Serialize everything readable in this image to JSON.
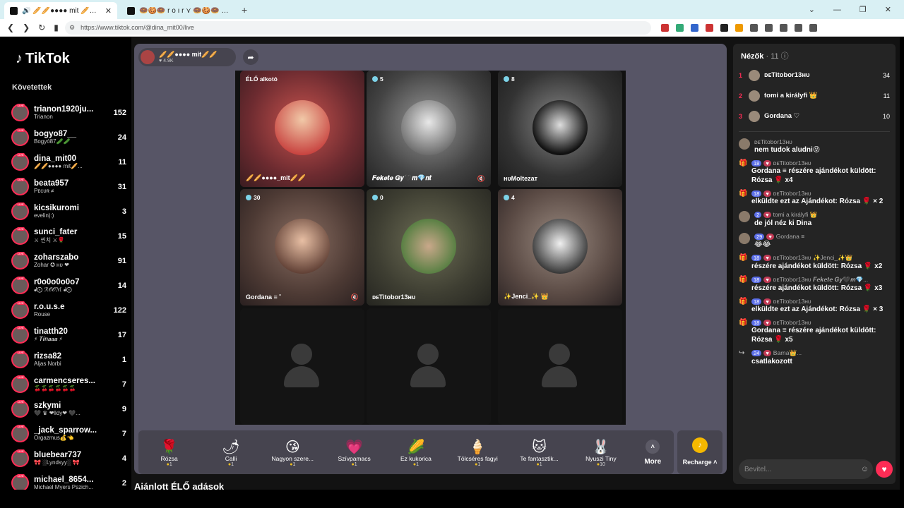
{
  "browser": {
    "tabs": [
      {
        "title": "🔊 🥖🥖●●●● mit 🥖🥖 (@…",
        "close": "✕"
      },
      {
        "title": "🍩🍪🍩 r o ı r ⋎ 🍩🍪🍩 (@tiktok.ro…"
      }
    ],
    "new_tab": "+",
    "url": "https://www.tiktok.com/@dina_mit00/live"
  },
  "sidebar": {
    "logo": "TikTok",
    "following_title": "Követettek",
    "items": [
      {
        "name": "trianon1920ju...",
        "sub": "Trianon",
        "count": "152"
      },
      {
        "name": "bogyo87__",
        "sub": "Bogyó87🥒🥒",
        "count": "24"
      },
      {
        "name": "dina_mit00",
        "sub": "🥖🥖●●●● mit🥖...",
        "count": "11"
      },
      {
        "name": "beata957",
        "sub": "Pᴇᴄᴜʀ ≠",
        "count": "31"
      },
      {
        "name": "kicsikuromi",
        "sub": "evelin):)",
        "count": "3"
      },
      {
        "name": "sunci_fater",
        "sub": "⚔ 씬치 ⚔🌹",
        "count": "15"
      },
      {
        "name": "zoharszabo",
        "sub": "Zohar ✪ ʜᴜ ❤",
        "count": "91"
      },
      {
        "name": "r0o0o0o0o7",
        "sub": "ᖱ⨀ ℛ𝒪𝒪ℳ ᖱ⨀",
        "count": "14"
      },
      {
        "name": "r.o.u.s.e",
        "sub": "Rouse",
        "count": "122"
      },
      {
        "name": "tinatth20",
        "sub": "⚡ 𝑻𝒊𝒏𝒂𝒂𝒂 ⚡",
        "count": "17"
      },
      {
        "name": "rizsa82",
        "sub": "Aljas Norbi",
        "count": "1"
      },
      {
        "name": "carmencseres...",
        "sub": "🍒🍒🍒🍒🍒🍒",
        "count": "7"
      },
      {
        "name": "szkymi",
        "sub": "🖤 ♛ ❤lldy❤ 🖤...",
        "count": "9"
      },
      {
        "name": "_jack_sparrow...",
        "sub": "Orgazmus💰👈",
        "count": "7"
      },
      {
        "name": "bluebear737",
        "sub": "🎀 ░Lyndsyy░ 🎀",
        "count": "4"
      },
      {
        "name": "michael_8654...",
        "sub": "Michael Myers Pszich...",
        "count": "2"
      }
    ]
  },
  "host": {
    "name": "🥖🥖●●●● mit🥖🥖",
    "likes": "♥ 4.9K"
  },
  "grid": {
    "cells": [
      {
        "badge": "ÉLŐ alkotó",
        "name": "🥖🥖●●●●_mit🥖🥖",
        "viewers": ""
      },
      {
        "badge": "5",
        "name": "𝑭𝒆𝒌𝒆𝒕𝒆 𝑮𝒚🖤𝒎💎𝒏𝒕",
        "viewers": "5"
      },
      {
        "badge": "8",
        "name": "ʜᴜMoltezaт",
        "viewers": "8"
      },
      {
        "badge": "30",
        "name": "Gordana ≡ ˚",
        "viewers": "30"
      },
      {
        "badge": "0",
        "name": "ᴅᴇTitobor13ʜᴜ",
        "viewers": "0"
      },
      {
        "badge": "4",
        "name": "✨Jenci_✨ 👑",
        "viewers": "4"
      }
    ]
  },
  "gifts": [
    {
      "icon": "🌹",
      "name": "Rózsa",
      "price": "1"
    },
    {
      "icon": "🌶",
      "name": "Calli",
      "price": "1"
    },
    {
      "icon": "😘",
      "name": "Nagyon szere...",
      "price": "1"
    },
    {
      "icon": "💗",
      "name": "Szívpamacs",
      "price": "1"
    },
    {
      "icon": "🌽",
      "name": "Ez kukorica",
      "price": "1"
    },
    {
      "icon": "🍦",
      "name": "Tölcséres fagyi",
      "price": "1"
    },
    {
      "icon": "🐱",
      "name": "Te fantasztik...",
      "price": "1"
    },
    {
      "icon": "🐰",
      "name": "Nyuszi Tiny",
      "price": "10"
    }
  ],
  "more_label": "More",
  "recharge_label": "Recharge ˄",
  "recommended_title": "Ajánlott ÉLŐ adások",
  "viewers_panel": {
    "title": "Nézők",
    "count": "· 11",
    "top": [
      {
        "rank": "1",
        "name": "ᴅᴇTitobor13ʜᴜ",
        "score": "34"
      },
      {
        "rank": "2",
        "name": "tomi a királyfi 👑",
        "score": "11"
      },
      {
        "rank": "3",
        "name": "Gordana ♡",
        "score": "10"
      }
    ]
  },
  "chat": [
    {
      "icon": "",
      "meta": "ᴅᴇTitobor13ʜᴜ",
      "text": "nem tudok aludni😜"
    },
    {
      "icon": "🎁",
      "meta": "ᴅᴇTitobor13ʜᴜ",
      "level": "18",
      "text": "Gordana ≡ részére ajándékot küldött: Rózsa 🌹 x4"
    },
    {
      "icon": "🎁",
      "meta": "ᴅᴇTitobor13ʜᴜ",
      "level": "18",
      "text": "elküldte ezt az Ajándékot: Rózsa 🌹 × 2"
    },
    {
      "icon": "",
      "meta": "tomi a királyfi 👑",
      "level": "2",
      "text": "de jól néz ki Dina"
    },
    {
      "icon": "",
      "meta": "Gordana ≡",
      "level": "29",
      "text": "😂😂"
    },
    {
      "icon": "🎁",
      "meta": "ᴅᴇTitobor13ʜᴜ ✨Jenci_✨👑",
      "level": "18",
      "text": "részére ajándékot küldött: Rózsa 🌹 x2"
    },
    {
      "icon": "🎁",
      "meta": "ᴅᴇTitobor13ʜᴜ 𝑭𝒆𝒌𝒆𝒕𝒆 𝑮𝒚🖤𝒎💎...",
      "level": "18",
      "text": "részére ajándékot küldött: Rózsa 🌹 x3"
    },
    {
      "icon": "🎁",
      "meta": "ᴅᴇTitobor13ʜᴜ",
      "level": "18",
      "text": "elküldte ezt az Ajándékot: Rózsa 🌹 × 3"
    },
    {
      "icon": "🎁",
      "meta": "ᴅᴇTitobor13ʜᴜ",
      "level": "18",
      "text": "Gordana ≡ részére ajándékot küldött: Rózsa 🌹 x5"
    },
    {
      "icon": "↪",
      "meta": "Barna👑...",
      "level": "24",
      "text": "csatlakozott"
    }
  ],
  "input_placeholder": "Bevitel...",
  "colors": {
    "accent": "#fe2c55",
    "panel": "#575566",
    "coin": "#f5b800"
  }
}
